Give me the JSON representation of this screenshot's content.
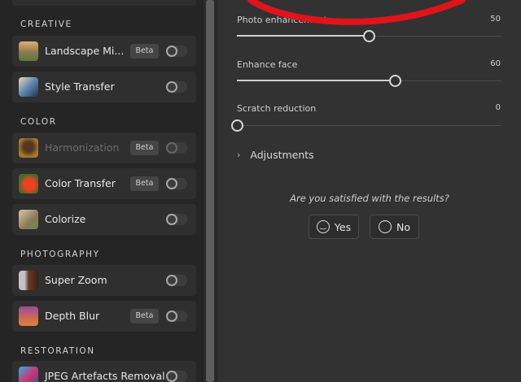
{
  "sections": {
    "creative": "CREATIVE",
    "color": "COLOR",
    "photography": "PHOTOGRAPHY",
    "restoration": "RESTORATION"
  },
  "filters": {
    "landscape": {
      "label": "Landscape Mi...",
      "badge": "Beta",
      "enabled": false
    },
    "style": {
      "label": "Style Transfer",
      "enabled": false
    },
    "harmonization": {
      "label": "Harmonization",
      "badge": "Beta",
      "enabled": false,
      "disabled": true
    },
    "color_transfer": {
      "label": "Color Transfer",
      "badge": "Beta",
      "enabled": false
    },
    "colorize": {
      "label": "Colorize",
      "enabled": false
    },
    "super_zoom": {
      "label": "Super Zoom",
      "enabled": false
    },
    "depth_blur": {
      "label": "Depth Blur",
      "badge": "Beta",
      "enabled": false
    },
    "jpeg": {
      "label": "JPEG Artefacts Removal",
      "enabled": false
    }
  },
  "sliders": {
    "photo": {
      "label": "Photo enhancement",
      "value": "50",
      "percent": 50
    },
    "face": {
      "label": "Enhance face",
      "value": "60",
      "percent": 60
    },
    "scratch": {
      "label": "Scratch reduction",
      "value": "0",
      "percent": 0
    }
  },
  "adjustments": "Adjustments",
  "feedback": {
    "question": "Are you satisfied with the results?",
    "yes": "Yes",
    "no": "No"
  },
  "colors": {
    "annotation": "#e0141b"
  }
}
